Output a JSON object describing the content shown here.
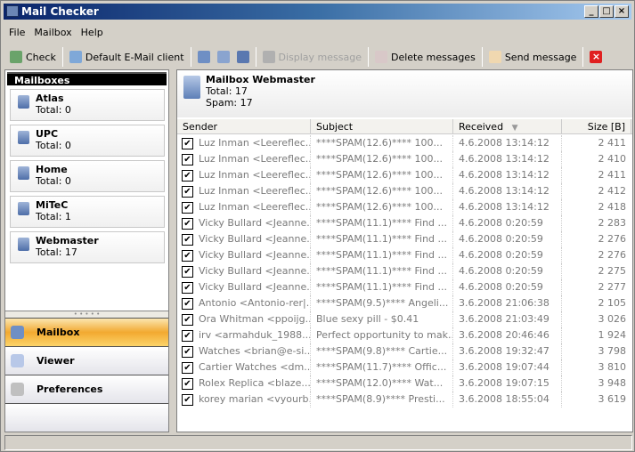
{
  "window": {
    "title": "Mail Checker"
  },
  "menu": [
    "File",
    "Mailbox",
    "Help"
  ],
  "toolbar": {
    "check": "Check",
    "default_client": "Default E-Mail client",
    "display": "Display message",
    "delete": "Delete messages",
    "send": "Send message"
  },
  "left": {
    "header": "Mailboxes",
    "mailboxes": [
      {
        "name": "Atlas",
        "total": "Total: 0"
      },
      {
        "name": "UPC",
        "total": "Total: 0"
      },
      {
        "name": "Home",
        "total": "Total: 0"
      },
      {
        "name": "MiTeC",
        "total": "Total: 1"
      },
      {
        "name": "Webmaster",
        "total": "Total: 17"
      }
    ],
    "nav": [
      "Mailbox",
      "Viewer",
      "Preferences"
    ]
  },
  "right": {
    "title": "Mailbox Webmaster",
    "total": "Total: 17",
    "spam": "Spam: 17",
    "columns": [
      "Sender",
      "Subject",
      "Received",
      "Size [B]"
    ],
    "rows": [
      [
        "Luz Inman <Leereflec...",
        "****SPAM(12.6)**** 100...",
        "4.6.2008 13:14:12",
        "2 411"
      ],
      [
        "Luz Inman <Leereflec...",
        "****SPAM(12.6)**** 100...",
        "4.6.2008 13:14:12",
        "2 410"
      ],
      [
        "Luz Inman <Leereflec...",
        "****SPAM(12.6)**** 100...",
        "4.6.2008 13:14:12",
        "2 411"
      ],
      [
        "Luz Inman <Leereflec...",
        "****SPAM(12.6)**** 100...",
        "4.6.2008 13:14:12",
        "2 412"
      ],
      [
        "Luz Inman <Leereflec...",
        "****SPAM(12.6)**** 100...",
        "4.6.2008 13:14:12",
        "2 418"
      ],
      [
        "Vicky Bullard <Jeanne...",
        "****SPAM(11.1)**** Find ...",
        "4.6.2008 0:20:59",
        "2 283"
      ],
      [
        "Vicky Bullard <Jeanne...",
        "****SPAM(11.1)**** Find ...",
        "4.6.2008 0:20:59",
        "2 276"
      ],
      [
        "Vicky Bullard <Jeanne...",
        "****SPAM(11.1)**** Find ...",
        "4.6.2008 0:20:59",
        "2 276"
      ],
      [
        "Vicky Bullard <Jeanne...",
        "****SPAM(11.1)**** Find ...",
        "4.6.2008 0:20:59",
        "2 275"
      ],
      [
        "Vicky Bullard <Jeanne...",
        "****SPAM(11.1)**** Find ...",
        "4.6.2008 0:20:59",
        "2 277"
      ],
      [
        "Antonio <Antonio-rer|...",
        "****SPAM(9.5)**** Angeli...",
        "3.6.2008 21:06:38",
        "2 105"
      ],
      [
        "Ora Whitman <ppoijg...",
        "Blue sexy pill - $0.41",
        "3.6.2008 21:03:49",
        "3 026"
      ],
      [
        "irv <armahduk_1988...",
        "Perfect opportunity to mak...",
        "3.6.2008 20:46:46",
        "1 924"
      ],
      [
        "Watches <brian@e-si...",
        "****SPAM(9.8)**** Cartie...",
        "3.6.2008 19:32:47",
        "3 798"
      ],
      [
        "Cartier Watches <dm...",
        "****SPAM(11.7)**** Offic...",
        "3.6.2008 19:07:44",
        "3 810"
      ],
      [
        "Rolex Replica <blaze...",
        "****SPAM(12.0)**** Wat...",
        "3.6.2008 19:07:15",
        "3 948"
      ],
      [
        "korey marian <vyourb...",
        "****SPAM(8.9)**** Presti...",
        "3.6.2008 18:55:04",
        "3 619"
      ]
    ]
  }
}
